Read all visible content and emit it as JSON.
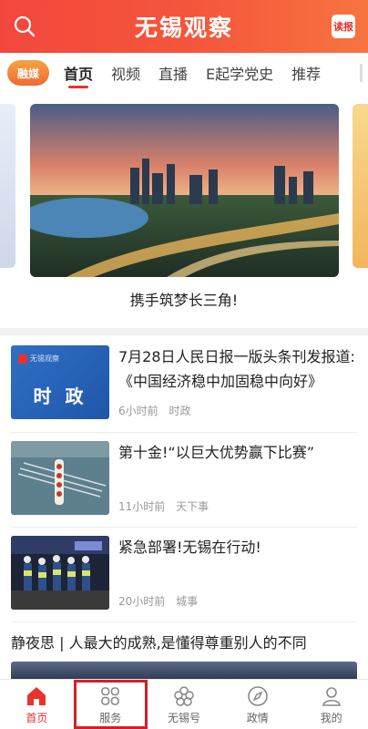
{
  "header": {
    "title": "无锡观察",
    "read_badge": "读报",
    "search_icon": "search-icon"
  },
  "tabs": {
    "logo_label": "融媒",
    "items": [
      {
        "label": "首页",
        "active": true
      },
      {
        "label": "视频",
        "active": false
      },
      {
        "label": "直播",
        "active": false
      },
      {
        "label": "E起学党史",
        "active": false
      },
      {
        "label": "推荐",
        "active": false
      }
    ]
  },
  "banner": {
    "caption": "携手筑梦长三角!"
  },
  "news": [
    {
      "headline": "7月28日人民日报一版头条刊发报道:《中国经济稳中加固稳中向好》",
      "time": "6小时前",
      "category": "时政",
      "thumb_label": "时 政",
      "thumb_tag": "无锡观察"
    },
    {
      "headline": "第十金!“以巨大优势赢下比赛”",
      "time": "11小时前",
      "category": "天下事"
    },
    {
      "headline": "紧急部署!无锡在行动!",
      "time": "20小时前",
      "category": "城事"
    }
  ],
  "bottom_headline": "静夜思 | 人最大的成熟,是懂得尊重别人的不同",
  "bottom_nav": [
    {
      "label": "首页",
      "icon": "home-icon",
      "active": true
    },
    {
      "label": "服务",
      "icon": "grid-icon",
      "active": false
    },
    {
      "label": "无锡号",
      "icon": "flower-icon",
      "active": false
    },
    {
      "label": "政情",
      "icon": "compass-icon",
      "active": false
    },
    {
      "label": "我的",
      "icon": "user-icon",
      "active": false
    }
  ],
  "colors": {
    "brand_red": "#e8322d",
    "header_gradient_start": "#f2473d",
    "header_gradient_end": "#f77440",
    "highlight_box": "#d41f26"
  }
}
